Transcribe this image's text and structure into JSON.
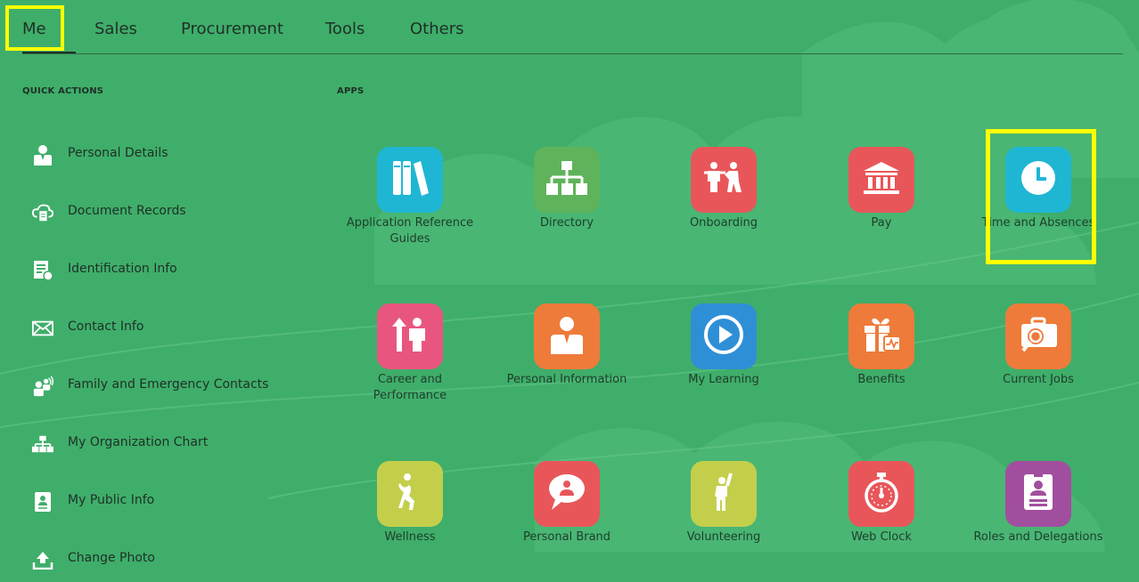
{
  "nav": {
    "tabs": [
      {
        "label": "Me",
        "active": true
      },
      {
        "label": "Sales"
      },
      {
        "label": "Procurement"
      },
      {
        "label": "Tools"
      },
      {
        "label": "Others"
      }
    ]
  },
  "quick_actions": {
    "title": "QUICK ACTIONS",
    "items": [
      {
        "label": "Personal Details",
        "icon": "person-icon"
      },
      {
        "label": "Document Records",
        "icon": "cloud-document-icon"
      },
      {
        "label": "Identification Info",
        "icon": "id-document-icon"
      },
      {
        "label": "Contact Info",
        "icon": "envelope-icon"
      },
      {
        "label": "Family and Emergency Contacts",
        "icon": "family-contacts-icon"
      },
      {
        "label": "My Organization Chart",
        "icon": "org-chart-icon"
      },
      {
        "label": "My Public Info",
        "icon": "badge-icon"
      },
      {
        "label": "Change Photo",
        "icon": "upload-icon"
      }
    ]
  },
  "apps": {
    "title": "APPS",
    "items": [
      {
        "label": "Application Reference Guides",
        "color": "#1fb6d4",
        "icon": "books-icon"
      },
      {
        "label": "Directory",
        "color": "#5fb35b",
        "icon": "org-chart-icon"
      },
      {
        "label": "Onboarding",
        "color": "#e8565a",
        "icon": "onboarding-icon"
      },
      {
        "label": "Pay",
        "color": "#e8565a",
        "icon": "bank-icon"
      },
      {
        "label": "Time and Absences",
        "color": "#1fb6d4",
        "icon": "clock-icon"
      },
      {
        "label": "Career and Performance",
        "color": "#e8567f",
        "icon": "career-icon"
      },
      {
        "label": "Personal Information",
        "color": "#ee7b3a",
        "icon": "person-card-icon"
      },
      {
        "label": "My Learning",
        "color": "#2f8fd6",
        "icon": "play-icon"
      },
      {
        "label": "Benefits",
        "color": "#ee7b3a",
        "icon": "gift-icon"
      },
      {
        "label": "Current Jobs",
        "color": "#ee7b3a",
        "icon": "briefcase-search-icon"
      },
      {
        "label": "Wellness",
        "color": "#c3cf4b",
        "icon": "wellness-icon"
      },
      {
        "label": "Personal Brand",
        "color": "#e8565a",
        "icon": "speech-person-icon"
      },
      {
        "label": "Volunteering",
        "color": "#c3cf4b",
        "icon": "volunteer-icon"
      },
      {
        "label": "Web Clock",
        "color": "#e8565a",
        "icon": "stopwatch-icon"
      },
      {
        "label": "Roles and Delegations",
        "color": "#a24e9e",
        "icon": "id-badge-icon"
      }
    ]
  }
}
